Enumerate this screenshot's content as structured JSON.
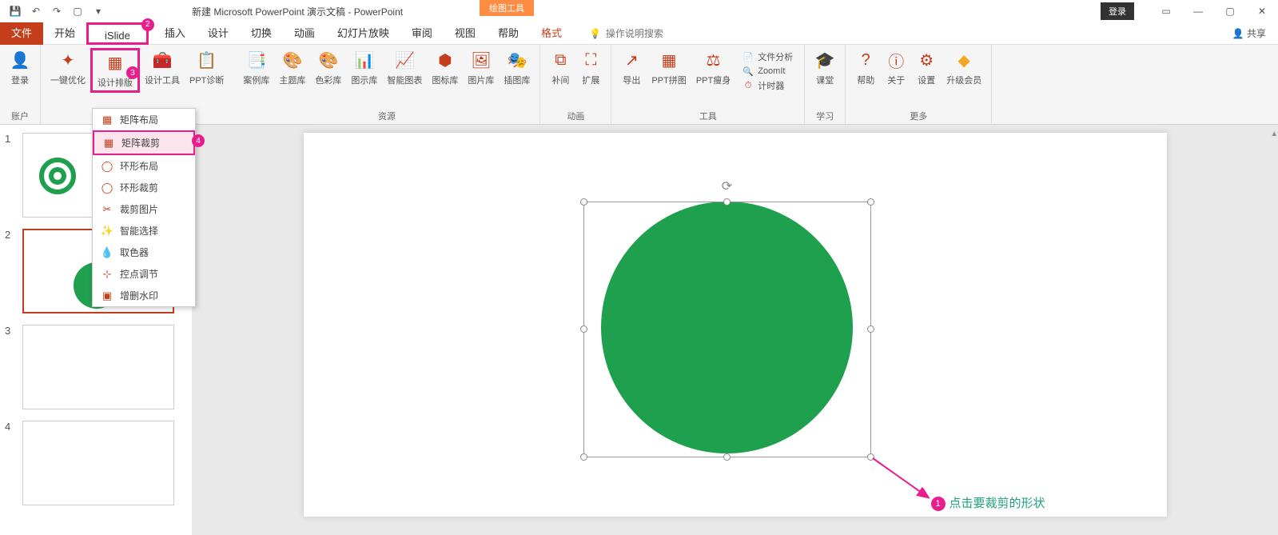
{
  "titlebar": {
    "title": "新建 Microsoft PowerPoint 演示文稿 - PowerPoint",
    "context_tool": "绘图工具",
    "login": "登录"
  },
  "tabs": {
    "file": "文件",
    "home": "开始",
    "islide": "iSlide",
    "insert": "插入",
    "design": "设计",
    "transition": "切换",
    "animation": "动画",
    "slideshow": "幻灯片放映",
    "review": "审阅",
    "view": "视图",
    "help": "帮助",
    "format": "格式",
    "tellme": "操作说明搜索",
    "share": "共享"
  },
  "ribbon": {
    "account": {
      "login": "登录",
      "label": "账户"
    },
    "design": {
      "oneclick": "一键优化",
      "layout": "设计排版",
      "tools": "设计工具",
      "diagnose": "PPT诊断"
    },
    "resources": {
      "cases": "案例库",
      "themes": "主题库",
      "colors": "色彩库",
      "charts": "图示库",
      "smart": "智能图表",
      "icons": "图标库",
      "images": "图片库",
      "illust": "插图库",
      "label": "资源"
    },
    "anim": {
      "supplement": "补间",
      "extend": "扩展",
      "label": "动画"
    },
    "tools": {
      "export": "导出",
      "puzzle": "PPT拼图",
      "diet": "PPT瘦身",
      "analyze": "文件分析",
      "zoomit": "ZoomIt",
      "timer": "计时器",
      "label": "工具"
    },
    "study": {
      "class": "课堂",
      "label": "学习"
    },
    "more": {
      "help": "帮助",
      "about": "关于",
      "settings": "设置",
      "upgrade": "升级会员",
      "label": "更多"
    }
  },
  "dropdown": {
    "items": [
      "矩阵布局",
      "矩阵裁剪",
      "环形布局",
      "环形裁剪",
      "裁剪图片",
      "智能选择",
      "取色器",
      "控点调节",
      "增删水印"
    ]
  },
  "slides": {
    "s1": "1",
    "s2": "2",
    "s3": "3",
    "s4": "4"
  },
  "annotations": {
    "click_shape": "点击要裁剪的形状",
    "b1": "1",
    "b2": "2",
    "b3": "3",
    "b4": "4"
  }
}
